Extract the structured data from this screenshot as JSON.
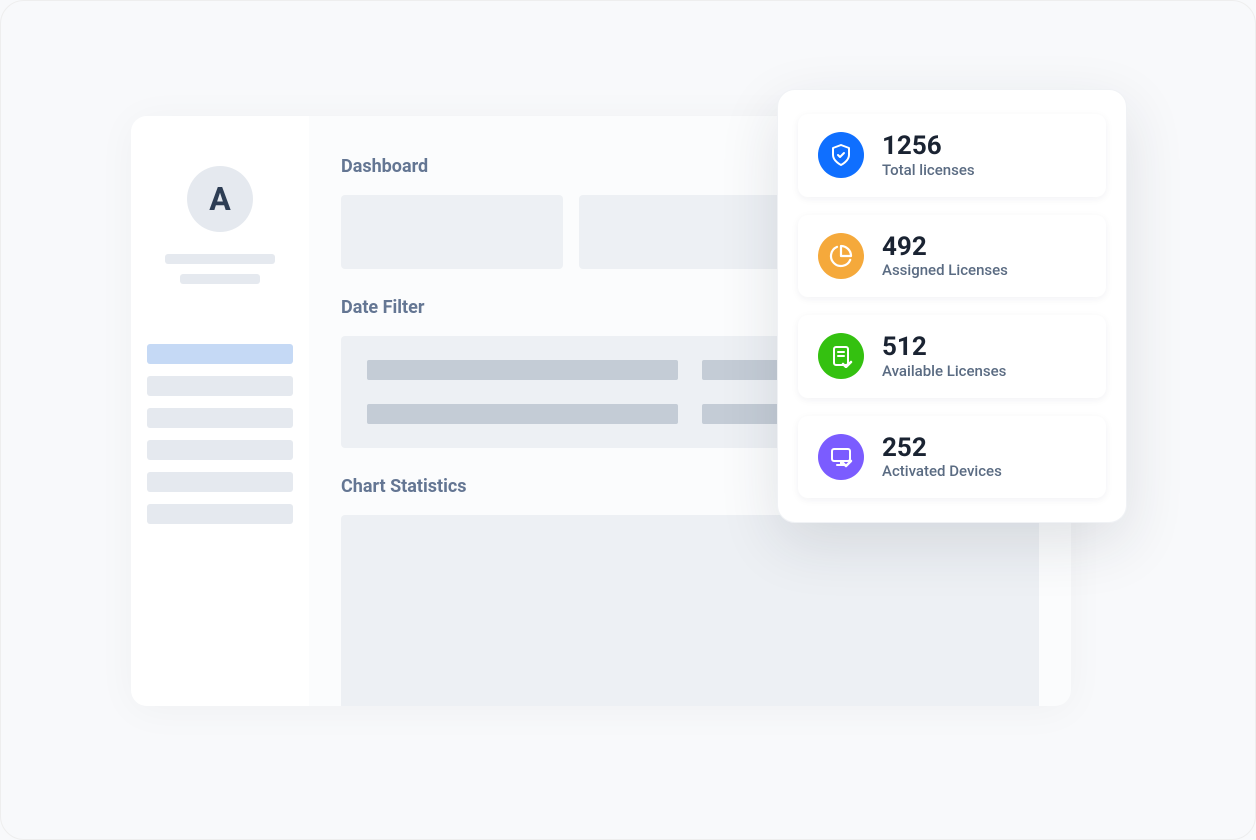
{
  "sidebar": {
    "avatar_initial": "A"
  },
  "main": {
    "dashboard_title": "Dashboard",
    "date_filter_title": "Date Filter",
    "chart_title": "Chart Statistics"
  },
  "stats": [
    {
      "value": "1256",
      "label": "Total licenses",
      "icon": "shield-check",
      "color": "blue"
    },
    {
      "value": "492",
      "label": "Assigned Licenses",
      "icon": "pie-chart",
      "color": "orange"
    },
    {
      "value": "512",
      "label": "Available Licenses",
      "icon": "document-check",
      "color": "green"
    },
    {
      "value": "252",
      "label": "Activated Devices",
      "icon": "monitor-check",
      "color": "purple"
    }
  ],
  "colors": {
    "blue": "#0f6fff",
    "orange": "#f5a93b",
    "green": "#34c110",
    "purple": "#7b5cff"
  }
}
